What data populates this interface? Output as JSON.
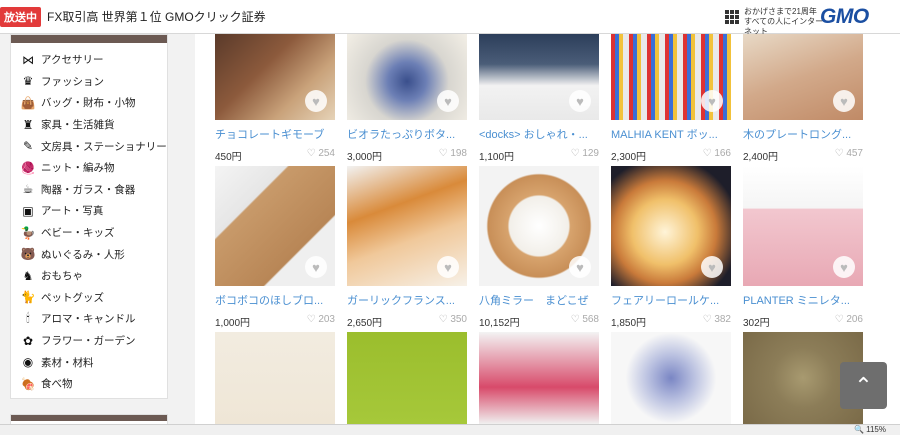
{
  "banner": {
    "badge": "放送中",
    "title": "FX取引高 世界第１位 GMOクリック証券",
    "promo_line1": "おかげさまで21周年",
    "promo_line2": "すべての人にインターネット",
    "logo": "GMO"
  },
  "sidebar": {
    "categories": [
      {
        "label": "アクセサリー",
        "icon": "bowtie-icon"
      },
      {
        "label": "ファッション",
        "icon": "dress-icon"
      },
      {
        "label": "バッグ・財布・小物",
        "icon": "bag-icon"
      },
      {
        "label": "家具・生活雑貨",
        "icon": "chair-icon"
      },
      {
        "label": "文房具・ステーショナリー",
        "icon": "stationery-icon"
      },
      {
        "label": "ニット・編み物",
        "icon": "knit-icon"
      },
      {
        "label": "陶器・ガラス・食器",
        "icon": "cup-icon"
      },
      {
        "label": "アート・写真",
        "icon": "frame-icon"
      },
      {
        "label": "ベビー・キッズ",
        "icon": "duck-icon"
      },
      {
        "label": "ぬいぐるみ・人形",
        "icon": "bear-icon"
      },
      {
        "label": "おもちゃ",
        "icon": "toy-icon"
      },
      {
        "label": "ペットグッズ",
        "icon": "cat-icon"
      },
      {
        "label": "アロマ・キャンドル",
        "icon": "candle-icon"
      },
      {
        "label": "フラワー・ガーデン",
        "icon": "flower-icon"
      },
      {
        "label": "素材・材料",
        "icon": "button-icon"
      },
      {
        "label": "食べ物",
        "icon": "food-icon"
      }
    ]
  },
  "products": [
    {
      "name": "チョコレートギモーブ",
      "price": "450円",
      "likes": "254"
    },
    {
      "name": "ビオラたっぷりボタ...",
      "price": "3,000円",
      "likes": "198"
    },
    {
      "name": "<docks> おしゃれ・...",
      "price": "1,100円",
      "likes": "129"
    },
    {
      "name": "MALHIA KENT ボッ...",
      "price": "2,300円",
      "likes": "166"
    },
    {
      "name": "木のプレートロング...",
      "price": "2,400円",
      "likes": "457"
    },
    {
      "name": "ボコボコのほしブロ...",
      "price": "1,000円",
      "likes": "203"
    },
    {
      "name": "ガーリックフランス...",
      "price": "2,650円",
      "likes": "350"
    },
    {
      "name": "八角ミラー　まどこぜ",
      "price": "10,152円",
      "likes": "568"
    },
    {
      "name": "フェアリーロールケ...",
      "price": "1,850円",
      "likes": "382"
    },
    {
      "name": "PLANTER ミニレタ...",
      "price": "302円",
      "likes": "206"
    }
  ],
  "status": {
    "zoom": "115%"
  },
  "colors": {
    "link": "#4a8fd1",
    "sidebar_head": "#6c5a53",
    "badge": "#e23a3a",
    "gmo": "#1b4fa2"
  }
}
